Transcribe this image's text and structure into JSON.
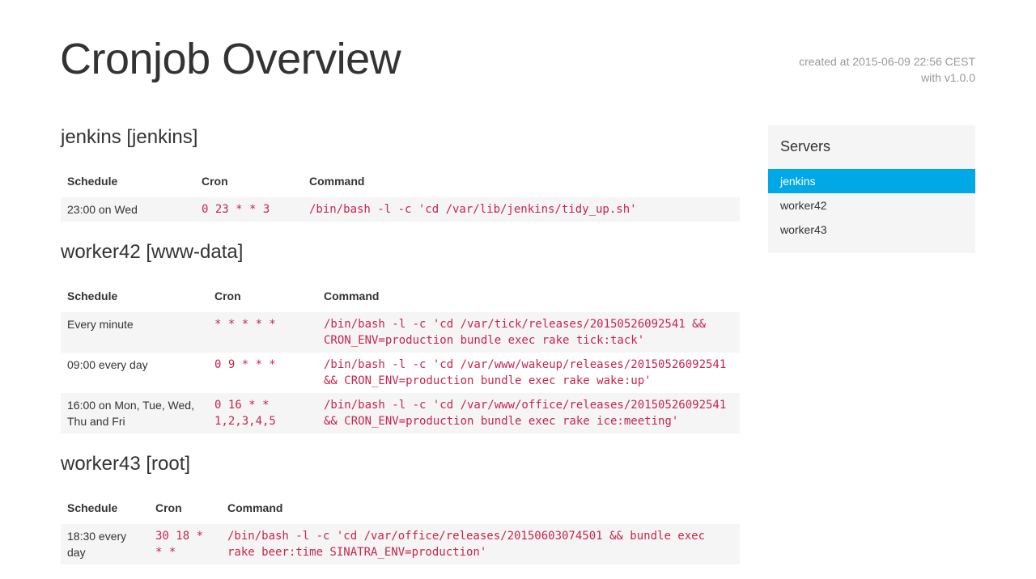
{
  "header": {
    "title": "Cronjob Overview",
    "created": "created at 2015-06-09 22:56 CEST",
    "version": "with v1.0.0"
  },
  "columns": {
    "schedule": "Schedule",
    "cron": "Cron",
    "command": "Command"
  },
  "servers": [
    {
      "heading": "jenkins [jenkins]",
      "jobs": [
        {
          "schedule": "23:00 on Wed",
          "cron": "0 23 * * 3",
          "command": "/bin/bash -l -c 'cd /var/lib/jenkins/tidy_up.sh'"
        }
      ]
    },
    {
      "heading": "worker42 [www-data]",
      "jobs": [
        {
          "schedule": "Every minute",
          "cron": "* * * * *",
          "command": "/bin/bash -l -c 'cd /var/tick/releases/20150526092541 && CRON_ENV=production bundle exec rake tick:tack'"
        },
        {
          "schedule": "09:00 every day",
          "cron": "0 9 * * *",
          "command": "/bin/bash -l -c 'cd /var/www/wakeup/releases/20150526092541 && CRON_ENV=production bundle exec rake wake:up'"
        },
        {
          "schedule": "16:00 on Mon, Tue, Wed, Thu and Fri",
          "cron": "0 16 * * 1,2,3,4,5",
          "command": "/bin/bash -l -c 'cd /var/www/office/releases/20150526092541 && CRON_ENV=production bundle exec rake ice:meeting'"
        }
      ]
    },
    {
      "heading": "worker43 [root]",
      "jobs": [
        {
          "schedule": "18:30 every day",
          "cron": "30 18 * * *",
          "command": "/bin/bash -l -c 'cd /var/office/releases/20150603074501 && bundle exec rake beer:time SINATRA_ENV=production'"
        }
      ]
    }
  ],
  "sidebar": {
    "title": "Servers",
    "items": [
      {
        "label": "jenkins",
        "active": true
      },
      {
        "label": "worker42",
        "active": false
      },
      {
        "label": "worker43",
        "active": false
      }
    ],
    "active_color": "#00a8e6"
  },
  "colors": {
    "code": "#c7254e",
    "stripe": "#f5f5f5",
    "meta": "#999999"
  }
}
